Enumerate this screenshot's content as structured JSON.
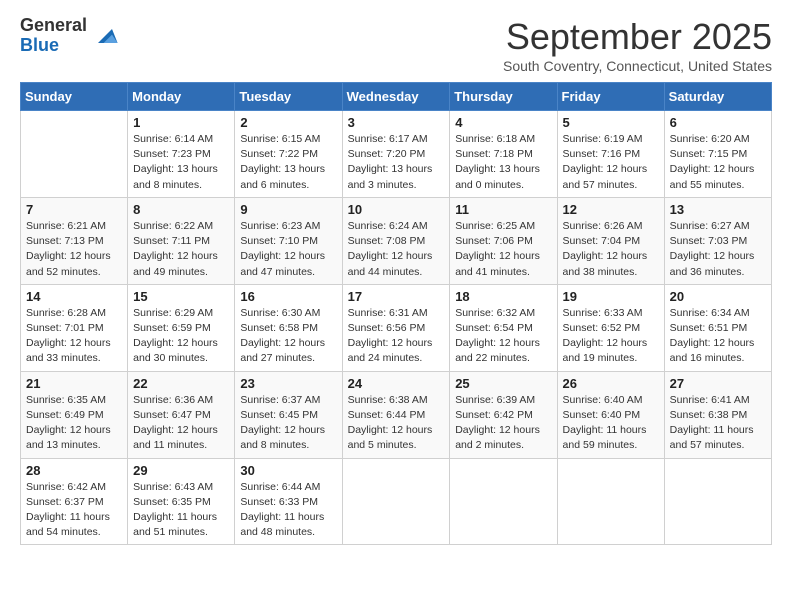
{
  "logo": {
    "general": "General",
    "blue": "Blue"
  },
  "title": "September 2025",
  "subtitle": "South Coventry, Connecticut, United States",
  "days_of_week": [
    "Sunday",
    "Monday",
    "Tuesday",
    "Wednesday",
    "Thursday",
    "Friday",
    "Saturday"
  ],
  "weeks": [
    [
      {
        "day": "",
        "info": ""
      },
      {
        "day": "1",
        "info": "Sunrise: 6:14 AM\nSunset: 7:23 PM\nDaylight: 13 hours\nand 8 minutes."
      },
      {
        "day": "2",
        "info": "Sunrise: 6:15 AM\nSunset: 7:22 PM\nDaylight: 13 hours\nand 6 minutes."
      },
      {
        "day": "3",
        "info": "Sunrise: 6:17 AM\nSunset: 7:20 PM\nDaylight: 13 hours\nand 3 minutes."
      },
      {
        "day": "4",
        "info": "Sunrise: 6:18 AM\nSunset: 7:18 PM\nDaylight: 13 hours\nand 0 minutes."
      },
      {
        "day": "5",
        "info": "Sunrise: 6:19 AM\nSunset: 7:16 PM\nDaylight: 12 hours\nand 57 minutes."
      },
      {
        "day": "6",
        "info": "Sunrise: 6:20 AM\nSunset: 7:15 PM\nDaylight: 12 hours\nand 55 minutes."
      }
    ],
    [
      {
        "day": "7",
        "info": "Sunrise: 6:21 AM\nSunset: 7:13 PM\nDaylight: 12 hours\nand 52 minutes."
      },
      {
        "day": "8",
        "info": "Sunrise: 6:22 AM\nSunset: 7:11 PM\nDaylight: 12 hours\nand 49 minutes."
      },
      {
        "day": "9",
        "info": "Sunrise: 6:23 AM\nSunset: 7:10 PM\nDaylight: 12 hours\nand 47 minutes."
      },
      {
        "day": "10",
        "info": "Sunrise: 6:24 AM\nSunset: 7:08 PM\nDaylight: 12 hours\nand 44 minutes."
      },
      {
        "day": "11",
        "info": "Sunrise: 6:25 AM\nSunset: 7:06 PM\nDaylight: 12 hours\nand 41 minutes."
      },
      {
        "day": "12",
        "info": "Sunrise: 6:26 AM\nSunset: 7:04 PM\nDaylight: 12 hours\nand 38 minutes."
      },
      {
        "day": "13",
        "info": "Sunrise: 6:27 AM\nSunset: 7:03 PM\nDaylight: 12 hours\nand 36 minutes."
      }
    ],
    [
      {
        "day": "14",
        "info": "Sunrise: 6:28 AM\nSunset: 7:01 PM\nDaylight: 12 hours\nand 33 minutes."
      },
      {
        "day": "15",
        "info": "Sunrise: 6:29 AM\nSunset: 6:59 PM\nDaylight: 12 hours\nand 30 minutes."
      },
      {
        "day": "16",
        "info": "Sunrise: 6:30 AM\nSunset: 6:58 PM\nDaylight: 12 hours\nand 27 minutes."
      },
      {
        "day": "17",
        "info": "Sunrise: 6:31 AM\nSunset: 6:56 PM\nDaylight: 12 hours\nand 24 minutes."
      },
      {
        "day": "18",
        "info": "Sunrise: 6:32 AM\nSunset: 6:54 PM\nDaylight: 12 hours\nand 22 minutes."
      },
      {
        "day": "19",
        "info": "Sunrise: 6:33 AM\nSunset: 6:52 PM\nDaylight: 12 hours\nand 19 minutes."
      },
      {
        "day": "20",
        "info": "Sunrise: 6:34 AM\nSunset: 6:51 PM\nDaylight: 12 hours\nand 16 minutes."
      }
    ],
    [
      {
        "day": "21",
        "info": "Sunrise: 6:35 AM\nSunset: 6:49 PM\nDaylight: 12 hours\nand 13 minutes."
      },
      {
        "day": "22",
        "info": "Sunrise: 6:36 AM\nSunset: 6:47 PM\nDaylight: 12 hours\nand 11 minutes."
      },
      {
        "day": "23",
        "info": "Sunrise: 6:37 AM\nSunset: 6:45 PM\nDaylight: 12 hours\nand 8 minutes."
      },
      {
        "day": "24",
        "info": "Sunrise: 6:38 AM\nSunset: 6:44 PM\nDaylight: 12 hours\nand 5 minutes."
      },
      {
        "day": "25",
        "info": "Sunrise: 6:39 AM\nSunset: 6:42 PM\nDaylight: 12 hours\nand 2 minutes."
      },
      {
        "day": "26",
        "info": "Sunrise: 6:40 AM\nSunset: 6:40 PM\nDaylight: 11 hours\nand 59 minutes."
      },
      {
        "day": "27",
        "info": "Sunrise: 6:41 AM\nSunset: 6:38 PM\nDaylight: 11 hours\nand 57 minutes."
      }
    ],
    [
      {
        "day": "28",
        "info": "Sunrise: 6:42 AM\nSunset: 6:37 PM\nDaylight: 11 hours\nand 54 minutes."
      },
      {
        "day": "29",
        "info": "Sunrise: 6:43 AM\nSunset: 6:35 PM\nDaylight: 11 hours\nand 51 minutes."
      },
      {
        "day": "30",
        "info": "Sunrise: 6:44 AM\nSunset: 6:33 PM\nDaylight: 11 hours\nand 48 minutes."
      },
      {
        "day": "",
        "info": ""
      },
      {
        "day": "",
        "info": ""
      },
      {
        "day": "",
        "info": ""
      },
      {
        "day": "",
        "info": ""
      }
    ]
  ]
}
